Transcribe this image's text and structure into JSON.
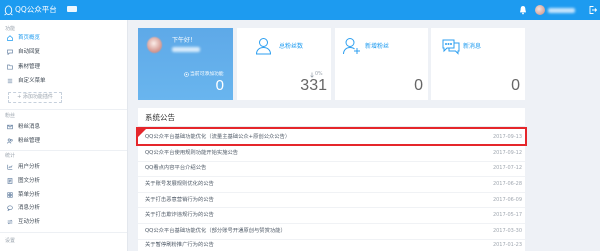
{
  "theme": {
    "accent": "#1d9bf0",
    "welcome_card": "#63afeb",
    "highlight_border": "#e5262b"
  },
  "header": {
    "logo_icon": "qq-penguin-icon",
    "title": "QQ公众平台",
    "icons": [
      "bell-icon",
      "avatar",
      "logout-icon"
    ]
  },
  "sidebar": {
    "sections": [
      {
        "title": "功能",
        "items": [
          {
            "label": "首页概览",
            "icon": "home-icon",
            "active": true
          },
          {
            "label": "自动回复",
            "icon": "reply-icon"
          },
          {
            "label": "素材管理",
            "icon": "folder-icon"
          },
          {
            "label": "自定义菜单",
            "icon": "menu-icon"
          }
        ]
      },
      {
        "title": "粉丝",
        "items": [
          {
            "label": "粉丝消息",
            "icon": "envelope-icon"
          },
          {
            "label": "粉丝管理",
            "icon": "users-icon"
          }
        ]
      },
      {
        "title": "统计",
        "items": [
          {
            "label": "用户分析",
            "icon": "line-chart-icon"
          },
          {
            "label": "图文分析",
            "icon": "article-icon"
          },
          {
            "label": "菜单分析",
            "icon": "grid-icon"
          },
          {
            "label": "消息分析",
            "icon": "chat-icon"
          },
          {
            "label": "互动分析",
            "icon": "interaction-icon"
          }
        ]
      },
      {
        "title": "设置",
        "items": []
      }
    ],
    "add_plugin_label": "+ 添加功能插件"
  },
  "welcome": {
    "greeting": "下午好！",
    "plugin_label": "当前可添加功能",
    "plugin_count": "0"
  },
  "stats": [
    {
      "label": "总粉丝数",
      "icon": "user-icon",
      "trend_icon": "arrow-down-icon",
      "change": "0%",
      "value": "331"
    },
    {
      "label": "新增粉丝",
      "icon": "user-add-icon",
      "value": "0"
    },
    {
      "label": "新消息",
      "icon": "message-bubbles-icon",
      "value": "0"
    }
  ],
  "announcements": {
    "title": "系统公告",
    "items": [
      {
        "text": "QQ公众平台基础功能优化（流量主基础公众+原创公众公告）",
        "date": "2017-09-13",
        "is_new": true
      },
      {
        "text": "QQ公众平台使用规则功能开始实施公告",
        "date": "2017-09-12"
      },
      {
        "text": "QQ看点内容平台介绍公告",
        "date": "2017-07-12"
      },
      {
        "text": "关于账号发展规则优化的公告",
        "date": "2017-06-28"
      },
      {
        "text": "关于打击恶意营销行为的公告",
        "date": "2017-06-09"
      },
      {
        "text": "关于打击欺诈违规行为的公告",
        "date": "2017-05-17"
      },
      {
        "text": "QQ公众平台基础功能优化（部分账号开通原创与赞赏功能）",
        "date": "2017-03-30"
      },
      {
        "text": "关于暂停刷粉推广行为的公告",
        "date": "2017-01-23"
      }
    ]
  }
}
